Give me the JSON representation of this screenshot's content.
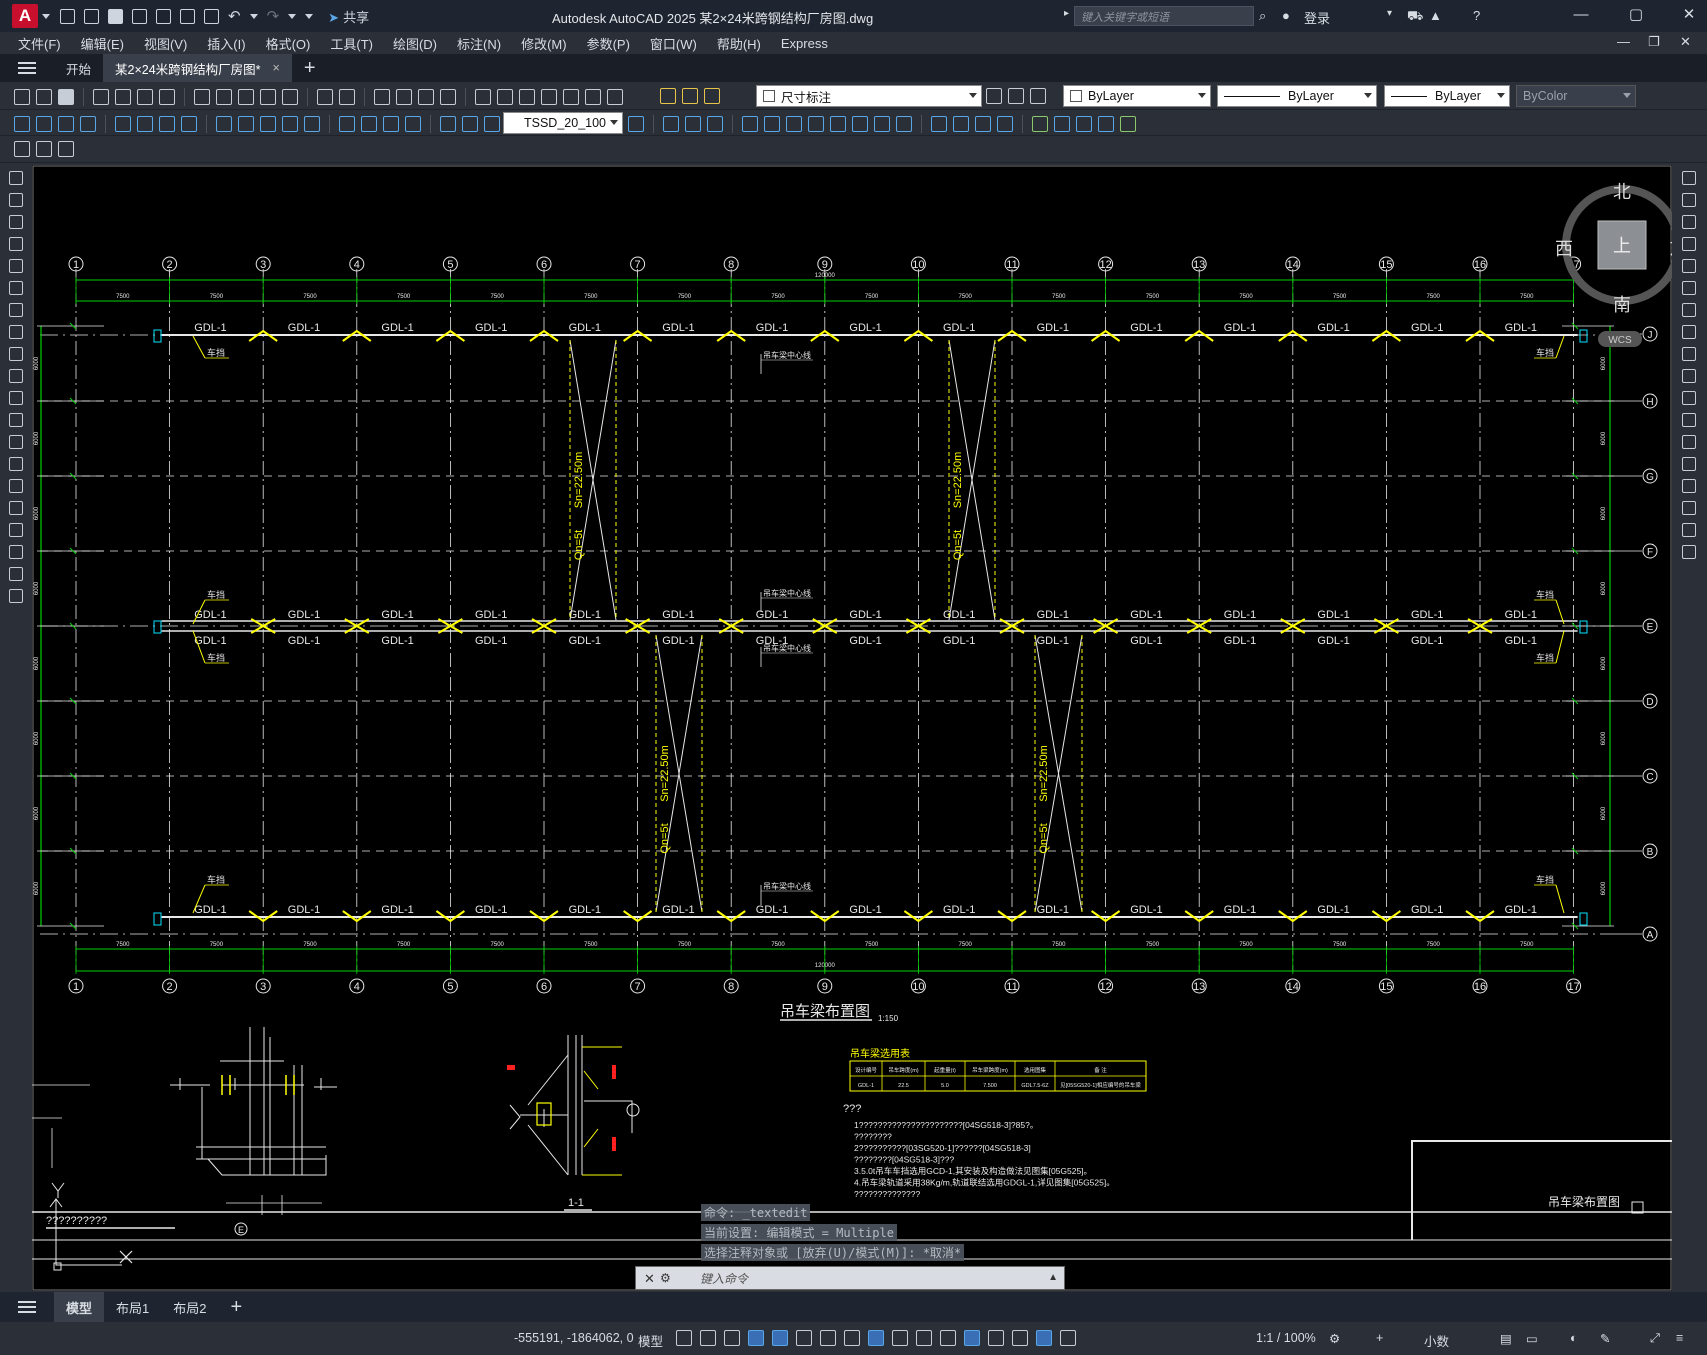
{
  "app": {
    "logo": "A",
    "title": "Autodesk AutoCAD 2025    某2×24米跨钢结构厂房图.dwg",
    "share_label": "共享",
    "search_placeholder": "键入关键字或短语",
    "login_label": "登录"
  },
  "menu": [
    "文件(F)",
    "编辑(E)",
    "视图(V)",
    "插入(I)",
    "格式(O)",
    "工具(T)",
    "绘图(D)",
    "标注(N)",
    "修改(M)",
    "参数(P)",
    "窗口(W)",
    "帮助(H)",
    "Express"
  ],
  "tabs": {
    "start": "开始",
    "doc": "某2×24米跨钢结构厂房图*",
    "close": "×"
  },
  "layer": {
    "current": "尺寸标注"
  },
  "properties": {
    "color": "ByLayer",
    "linetype": "ByLayer",
    "lineweight": "ByLayer",
    "plotstyle": "ByColor"
  },
  "dimstyle": {
    "current": "TSSD_20_100"
  },
  "viewcube": {
    "north": "北",
    "south": "南",
    "east": "东",
    "west": "西",
    "top": "上",
    "wcs": "WCS"
  },
  "drawing": {
    "grid_numbers": [
      "1",
      "2",
      "3",
      "4",
      "5",
      "6",
      "7",
      "8",
      "9",
      "10",
      "11",
      "12",
      "13",
      "14",
      "15",
      "16",
      "17"
    ],
    "grid_letters": [
      "J",
      "H",
      "G",
      "F",
      "E",
      "D",
      "C",
      "B",
      "A"
    ],
    "span_dim": "7500",
    "total_dim": "120000",
    "side_dim": "6000",
    "beam_label": "GDL-1",
    "stop_label": "车挡",
    "centerline_label": "吊车梁中心线",
    "brace_sn": "Sn=22.50m",
    "brace_qn": "Qn=5t",
    "plan_title": "吊车梁布置图",
    "plan_scale": "1:150",
    "table_title": "吊车梁选用表",
    "table_headers": [
      "设计编号",
      "吊车跨度(m)",
      "起重量(t)",
      "吊车梁跨度(m)",
      "选用图集",
      "备 注"
    ],
    "table_row": [
      "GDL-1",
      "22.5",
      "5.0",
      "7.500",
      "GDL7.5-6Z",
      "见[05SG520-1]相应编号的吊车梁"
    ],
    "notes_title": "???",
    "notes": [
      "1??????????????????????[04SG518-3]?85?。",
      "  ????????",
      "2??????????[03SG520-1]??????[04SG518-3]",
      "  ????????[04SG518-3]???",
      "   3.5.0t吊车车挡选用GCD-1,其安装及构造做法见图集[05G525]。",
      "   4.吊车梁轨道采用38Kg/m,轨道联结选用GDGL-1,详见图集[05G525]。",
      "  ??????????????"
    ],
    "section_label": "1-1",
    "detail_label": "E",
    "title_block": "吊车梁布置图",
    "ucs_text": "??????????"
  },
  "commands": {
    "line1": "命令: _textedit",
    "line2": "当前设置: 编辑模式 = Multiple",
    "line3": "选择注释对象或 [放弃(U)/模式(M)]: *取消*",
    "input_placeholder": "键入命令"
  },
  "layouts": [
    "模型",
    "布局1",
    "布局2"
  ],
  "status": {
    "coords": "-555191, -1864062, 0",
    "model": "模型",
    "scale": "1:1 / 100%",
    "units": "小数"
  }
}
